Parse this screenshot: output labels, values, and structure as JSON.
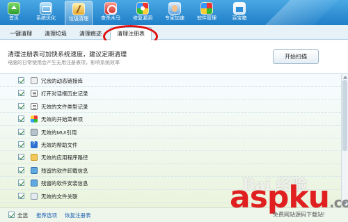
{
  "toolbar": {
    "items": [
      {
        "label": "首页",
        "icon": "home-icon"
      },
      {
        "label": "系统优化",
        "icon": "system-optimize-icon"
      },
      {
        "label": "垃圾清理",
        "icon": "broom-icon"
      },
      {
        "label": "查杀木马",
        "icon": "trojan-scan-icon"
      },
      {
        "label": "修复漏洞",
        "icon": "patch-fix-icon"
      },
      {
        "label": "专家加速",
        "icon": "expert-speedup-icon"
      },
      {
        "label": "软件管理",
        "icon": "software-manager-icon"
      },
      {
        "label": "百宝箱",
        "icon": "toolbox-icon"
      }
    ],
    "active_index": 2
  },
  "tabs": {
    "items": [
      "一键清理",
      "清理垃圾",
      "清理痕迹",
      "清理注册表"
    ],
    "selected": "清理注册表"
  },
  "header": {
    "title": "清理注册表可加快系统速度，建议定期清理",
    "subtitle": "电脑的日常使用会产生无用注册表项，影响系统效率",
    "scan_button": "开始扫描"
  },
  "registry_items": [
    {
      "label": "冗余的动态链接库",
      "checked": true,
      "icon": "chain-link-icon"
    },
    {
      "label": "打开对话框历史记录",
      "checked": true,
      "icon": "document-icon"
    },
    {
      "label": "无效的文件类型记录",
      "checked": true,
      "icon": "document-icon"
    },
    {
      "label": "无效的开始菜单项",
      "checked": true,
      "icon": "windows-start-icon"
    },
    {
      "label": "无效的MUI引用",
      "checked": true,
      "icon": "gear-icon"
    },
    {
      "label": "无效的帮助文件",
      "checked": true,
      "icon": "help-icon"
    },
    {
      "label": "无效的应用程序路径",
      "checked": true,
      "icon": "folder-icon"
    },
    {
      "label": "残留的软件卸载信息",
      "checked": true,
      "icon": "app-icon"
    },
    {
      "label": "残留的软件安装信息",
      "checked": true,
      "icon": "app-icon"
    },
    {
      "label": "无效的文件关联",
      "checked": true,
      "icon": "file-icon"
    }
  ],
  "footer": {
    "select_all": "全选",
    "recommended": "推荐选项",
    "restore": "恢复注册表"
  },
  "watermarks": {
    "baidu": "Bai 经验",
    "site": "aspku",
    "tld": ".com",
    "slogan": "免费网站源码下载站!"
  },
  "colors": {
    "toolbar_blue": "#1f7fc8",
    "annotation_red": "#e01010",
    "link_blue": "#1a5fb4"
  }
}
